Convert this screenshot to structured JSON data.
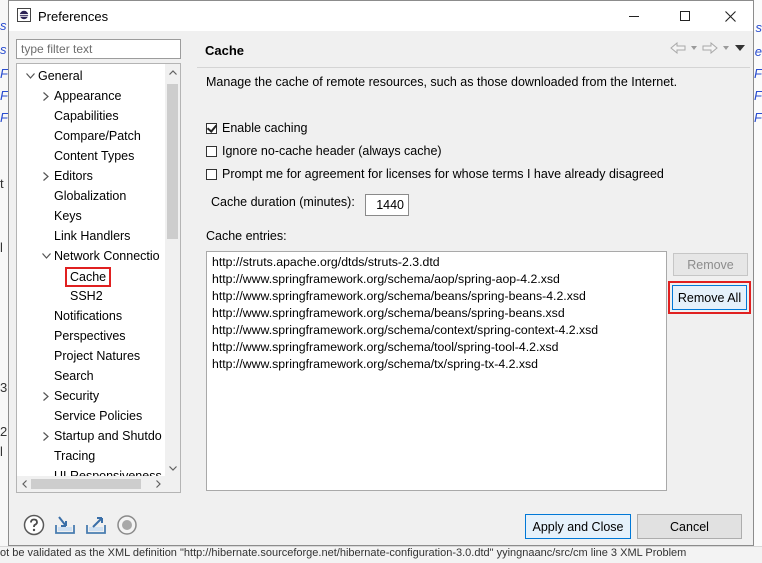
{
  "window": {
    "title": "Preferences"
  },
  "filter": {
    "placeholder": "type filter text"
  },
  "tree": {
    "items": [
      {
        "label": "General",
        "indent": 0,
        "arrow": "down"
      },
      {
        "label": "Appearance",
        "indent": 1,
        "arrow": "right"
      },
      {
        "label": "Capabilities",
        "indent": 1,
        "arrow": ""
      },
      {
        "label": "Compare/Patch",
        "indent": 1,
        "arrow": ""
      },
      {
        "label": "Content Types",
        "indent": 1,
        "arrow": ""
      },
      {
        "label": "Editors",
        "indent": 1,
        "arrow": "right"
      },
      {
        "label": "Globalization",
        "indent": 1,
        "arrow": ""
      },
      {
        "label": "Keys",
        "indent": 1,
        "arrow": ""
      },
      {
        "label": "Link Handlers",
        "indent": 1,
        "arrow": ""
      },
      {
        "label": "Network Connectio",
        "indent": 1,
        "arrow": "down"
      },
      {
        "label": "Cache",
        "indent": 2,
        "arrow": "",
        "selected": true
      },
      {
        "label": "SSH2",
        "indent": 2,
        "arrow": ""
      },
      {
        "label": "Notifications",
        "indent": 1,
        "arrow": ""
      },
      {
        "label": "Perspectives",
        "indent": 1,
        "arrow": ""
      },
      {
        "label": "Project Natures",
        "indent": 1,
        "arrow": ""
      },
      {
        "label": "Search",
        "indent": 1,
        "arrow": ""
      },
      {
        "label": "Security",
        "indent": 1,
        "arrow": "right"
      },
      {
        "label": "Service Policies",
        "indent": 1,
        "arrow": ""
      },
      {
        "label": "Startup and Shutdo",
        "indent": 1,
        "arrow": "right"
      },
      {
        "label": "Tracing",
        "indent": 1,
        "arrow": ""
      },
      {
        "label": "UI Responsiveness",
        "indent": 1,
        "arrow": ""
      }
    ]
  },
  "page": {
    "title": "Cache",
    "description": "Manage the cache of remote resources, such as those downloaded from the Internet.",
    "enable_caching": {
      "label": "Enable caching",
      "checked": true
    },
    "ignore_no_cache": {
      "label": "Ignore no-cache header (always cache)",
      "checked": false
    },
    "prompt_agreement": {
      "label": "Prompt me for agreement for licenses for whose terms I have already disagreed",
      "checked": false
    },
    "duration_label": "Cache duration (minutes):",
    "duration_value": "1440",
    "entries_label": "Cache entries:",
    "entries": [
      "http://struts.apache.org/dtds/struts-2.3.dtd",
      "http://www.springframework.org/schema/aop/spring-aop-4.2.xsd",
      "http://www.springframework.org/schema/beans/spring-beans-4.2.xsd",
      "http://www.springframework.org/schema/beans/spring-beans.xsd",
      "http://www.springframework.org/schema/context/spring-context-4.2.xsd",
      "http://www.springframework.org/schema/tool/spring-tool-4.2.xsd",
      "http://www.springframework.org/schema/tx/spring-tx-4.2.xsd"
    ],
    "remove_label": "Remove",
    "remove_all_label": "Remove All"
  },
  "footer": {
    "apply_close_label": "Apply and Close",
    "cancel_label": "Cancel",
    "icons": [
      "help-icon",
      "import-icon",
      "export-icon",
      "record-icon"
    ]
  },
  "background": {
    "bottom_text": "ot be validated as the XML definition \"http://hibernate.sourceforge.net/hibernate-configuration-3.0.dtd\"    yyingnaanc/src/cm    line 3    XML Problem"
  },
  "colors": {
    "accent": "#0078d7",
    "highlight": "#e02020",
    "link": "#2a4dd0"
  }
}
